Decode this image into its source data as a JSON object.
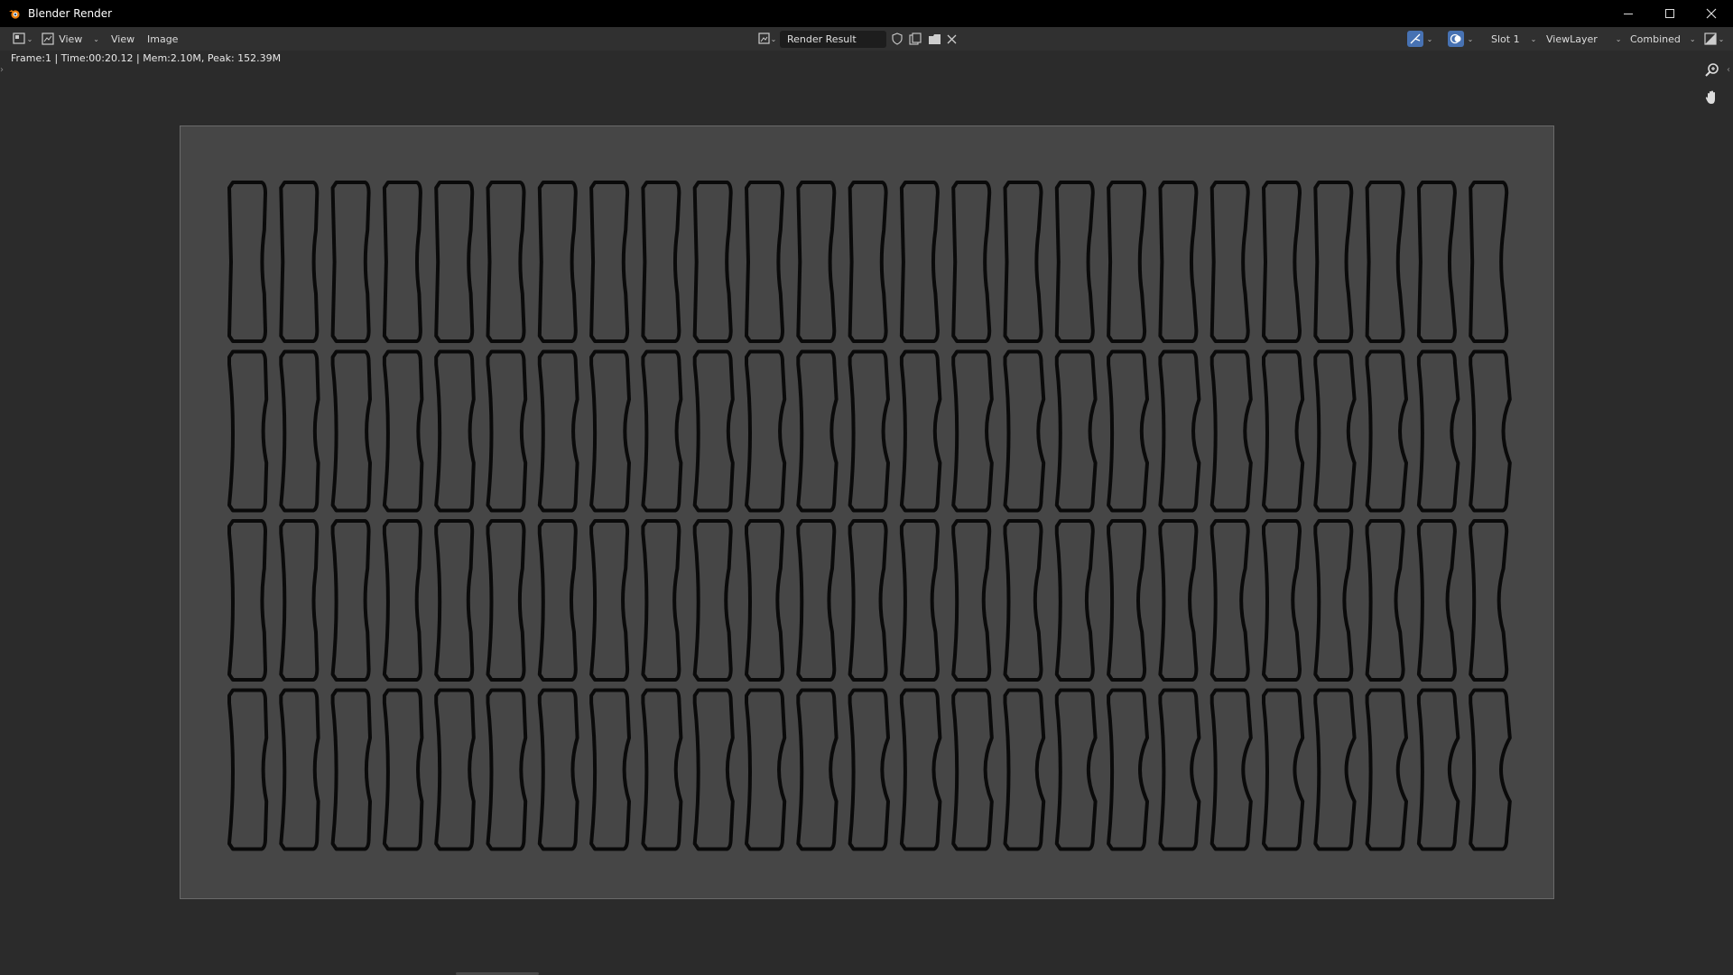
{
  "window": {
    "title": "Blender Render"
  },
  "header": {
    "editor_type_icon": "image-editor-icon",
    "view_mode_label": "View",
    "menus": [
      "View",
      "Image"
    ],
    "image_name": "Render Result",
    "slot_label": "Slot 1",
    "view_layer_label": "ViewLayer",
    "pass_label": "Combined"
  },
  "status": {
    "text": "Frame:1 | Time:00:20.12 | Mem:2.10M, Peak: 152.39M"
  },
  "render": {
    "rows": 4,
    "columns": 25,
    "background_color": "#464646",
    "outline_color": "#0a0a0a"
  },
  "colors": {
    "titlebar": "#000000",
    "header": "#303030",
    "viewport": "#2b2b2b",
    "accent": "#4772b3"
  }
}
